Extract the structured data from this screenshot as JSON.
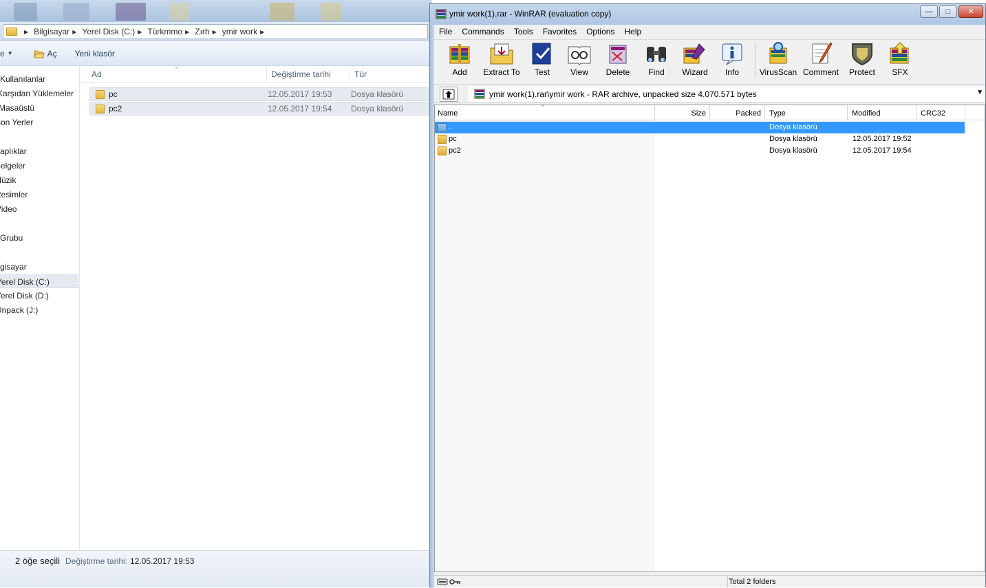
{
  "explorer": {
    "breadcrumb": [
      "Bilgisayar",
      "Yerel Disk (C:)",
      "Türkmmo",
      "Zırh",
      "ymir work"
    ],
    "toolbar": {
      "organize_fragment": "e",
      "open_label": "Aç",
      "new_folder_label": "Yeni klasör"
    },
    "nav": [
      {
        "label": "Kullanılanlar",
        "top": 0
      },
      {
        "label": "Karşıdan Yüklemeler",
        "top": 0
      },
      {
        "label": "Masaüstü",
        "top": 0
      },
      {
        "label": "Son Yerler",
        "top": 0
      },
      {
        "label": "aplıklar",
        "top": 0
      },
      {
        "label": "Belgeler",
        "top": 0
      },
      {
        "label": "Müzik",
        "top": 0
      },
      {
        "label": "Resimler",
        "top": 0
      },
      {
        "label": "Video",
        "top": 0
      },
      {
        "label": "Grubu",
        "top": 0
      },
      {
        "label": "gisayar",
        "top": 0
      },
      {
        "label": "Yerel Disk (C:)",
        "top": 0
      },
      {
        "label": "Yerel Disk (D:)",
        "top": 0
      },
      {
        "label": "Unpack (J:)",
        "top": 0
      }
    ],
    "columns": {
      "name": "Ad",
      "modified": "Değiştirme tarihi",
      "type": "Tür"
    },
    "rows": [
      {
        "name": "pc",
        "modified": "12.05.2017 19:53",
        "type": "Dosya klasörü"
      },
      {
        "name": "pc2",
        "modified": "12.05.2017 19:54",
        "type": "Dosya klasörü"
      }
    ],
    "status": {
      "selection": "2 öğe seçili",
      "modified_label": "Değiştirme tarihi:",
      "modified_value": "12.05.2017 19:53"
    }
  },
  "winrar": {
    "title": "ymir work(1).rar - WinRAR (evaluation copy)",
    "window_buttons": {
      "minimize": "—",
      "maximize": "□",
      "close": "✕"
    },
    "menu": [
      "File",
      "Commands",
      "Tools",
      "Favorites",
      "Options",
      "Help"
    ],
    "toolbar": [
      "Add",
      "Extract To",
      "Test",
      "View",
      "Delete",
      "Find",
      "Wizard",
      "Info",
      "VirusScan",
      "Comment",
      "Protect",
      "SFX"
    ],
    "path": "ymir work(1).rar\\ymir work - RAR archive, unpacked size 4.070.571 bytes",
    "columns": {
      "name": "Name",
      "size": "Size",
      "packed": "Packed",
      "type": "Type",
      "modified": "Modified",
      "crc": "CRC32"
    },
    "rows": [
      {
        "name": "..",
        "type": "Dosya klasörü",
        "modified": ""
      },
      {
        "name": "pc",
        "type": "Dosya klasörü",
        "modified": "12.05.2017 19:52"
      },
      {
        "name": "pc2",
        "type": "Dosya klasörü",
        "modified": "12.05.2017 19:54"
      }
    ],
    "status": "Total 2 folders"
  },
  "colors": {
    "selection": "#3399ff",
    "explorer_selection": "#e5eaf0",
    "title_bar": "#b7cce6"
  },
  "icons": {
    "toolbar": [
      "add-icon",
      "extract-to-icon",
      "test-icon",
      "view-icon",
      "delete-icon",
      "find-icon",
      "wizard-icon",
      "info-icon",
      "virusscan-icon",
      "comment-icon",
      "protect-icon",
      "sfx-icon"
    ]
  }
}
